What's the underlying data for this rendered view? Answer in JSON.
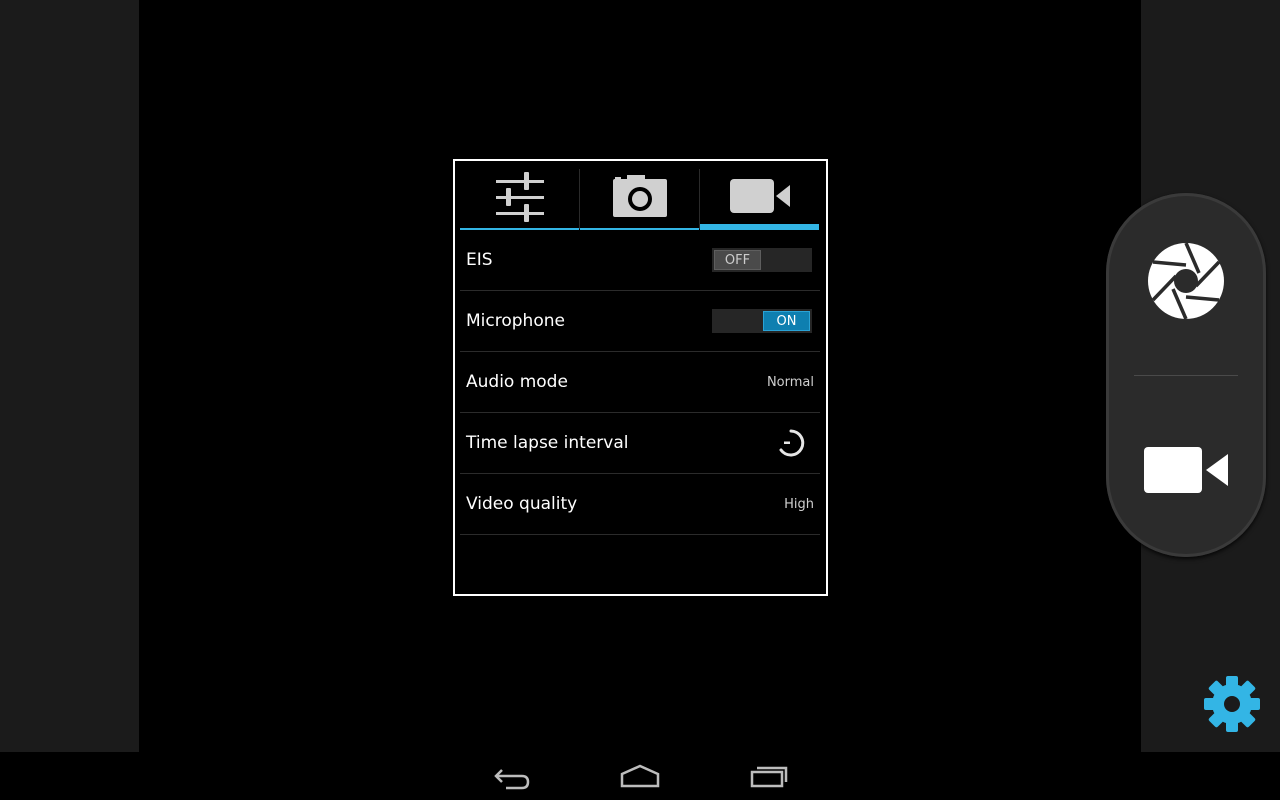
{
  "settings_panel": {
    "tabs": [
      {
        "name": "general-settings",
        "icon": "sliders-icon",
        "active": false
      },
      {
        "name": "photo-settings",
        "icon": "camera-icon",
        "active": false
      },
      {
        "name": "video-settings",
        "icon": "video-camera-icon",
        "active": true
      }
    ],
    "rows": [
      {
        "label": "EIS",
        "type": "toggle",
        "value": "OFF"
      },
      {
        "label": "Microphone",
        "type": "toggle",
        "value": "ON"
      },
      {
        "label": "Audio mode",
        "type": "value",
        "value": "Normal"
      },
      {
        "label": "Time lapse interval",
        "type": "icon",
        "icon": "timer-icon"
      },
      {
        "label": "Video quality",
        "type": "value",
        "value": "High"
      }
    ]
  },
  "controls": {
    "shutter_icon": "shutter-icon",
    "video_icon": "video-camera-icon",
    "settings_icon": "gear-icon"
  },
  "navbar": {
    "buttons": [
      "back-icon",
      "home-icon",
      "recent-apps-icon"
    ]
  },
  "colors": {
    "accent": "#33b5e5",
    "toggle_on": "#0e7fb0",
    "toggle_off": "#4a4a4a"
  }
}
